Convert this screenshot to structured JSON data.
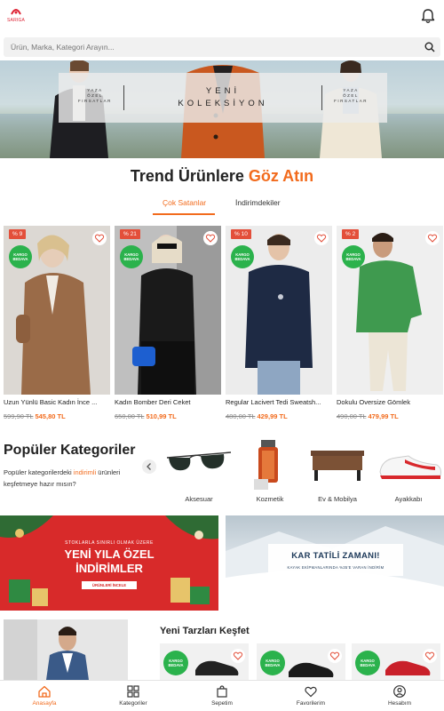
{
  "header": {
    "logo_text": "SARIGA",
    "search_placeholder": "Ürün, Marka, Kategori Arayın..."
  },
  "hero": {
    "left_text": [
      "YAZA",
      "ÖZEL",
      "FIRSATLAR"
    ],
    "center_text": [
      "YENİ",
      "KOLEKSİYON"
    ],
    "right_text": [
      "YAZA",
      "ÖZEL",
      "FIRSATLAR"
    ]
  },
  "trend": {
    "title_main": "Trend Ürünlere ",
    "title_accent": "Göz Atın",
    "tabs": [
      "Çok Satanlar",
      "İndirimdekiler"
    ],
    "active_tab": 0
  },
  "products": [
    {
      "discount": "% 9",
      "badge": [
        "KARGO",
        "BEDAVA"
      ],
      "name": "Uzun Yünlü Basic Kadın İnce ...",
      "old_price": "599,90 TL",
      "price": "545,80 TL"
    },
    {
      "discount": "% 21",
      "badge": [
        "KARGO",
        "BEDAVA"
      ],
      "name": "Kadın Bomber Deri Ceket",
      "old_price": "650,00 TL",
      "price": "510,99 TL"
    },
    {
      "discount": "% 10",
      "badge": [
        "KARGO",
        "BEDAVA"
      ],
      "name": "Regular Lacivert Tedi Sweatsh...",
      "old_price": "480,00 TL",
      "price": "429,99 TL"
    },
    {
      "discount": "% 2",
      "badge": [
        "KARGO",
        "BEDAVA"
      ],
      "name": "Dokulu Oversize Gömlek",
      "old_price": "490,00 TL",
      "price": "479,99 TL"
    }
  ],
  "categories_section": {
    "title": "Popüler Kategoriler",
    "desc_before": "Popüler kategorilerdeki ",
    "desc_accent": "indirimli",
    "desc_after": " ürünleri keşfetmeye hazır mısın?",
    "items": [
      {
        "label": "Aksesuar",
        "icon": "sunglasses-icon"
      },
      {
        "label": "Kozmetik",
        "icon": "perfume-icon"
      },
      {
        "label": "Ev & Mobilya",
        "icon": "desk-icon"
      },
      {
        "label": "Ayakkabı",
        "icon": "sneaker-icon"
      }
    ]
  },
  "banners": {
    "left": {
      "top_text": "STOKLARLA SINIRLI OLMAK ÜZERE",
      "title_line1": "YENİ YILA ÖZEL",
      "title_line2": "İNDİRİMLER",
      "button": "ÜRÜNLERİ İNCELE"
    },
    "right": {
      "title": "KAR TATİLİ ZAMANI!",
      "subtitle": "KAYAK EKİPMANLARINDA %35'E VARAN İNDİRİM"
    }
  },
  "explore": {
    "title": "Yeni Tarzları Keşfet",
    "badge": [
      "KARGO",
      "BEDAVA"
    ]
  },
  "bottom_nav": [
    {
      "label": "Anasayfa",
      "icon": "home-icon",
      "active": true
    },
    {
      "label": "Kategoriler",
      "icon": "grid-icon",
      "active": false
    },
    {
      "label": "Sepetim",
      "icon": "bag-icon",
      "active": false
    },
    {
      "label": "Favorilerim",
      "icon": "heart-icon",
      "active": false
    },
    {
      "label": "Hesabım",
      "icon": "account-icon",
      "active": false
    }
  ],
  "colors": {
    "accent": "#f26b1d",
    "discount": "#e34f3a",
    "kargo": "#2bb24c",
    "banner_red": "#d82a2a"
  }
}
